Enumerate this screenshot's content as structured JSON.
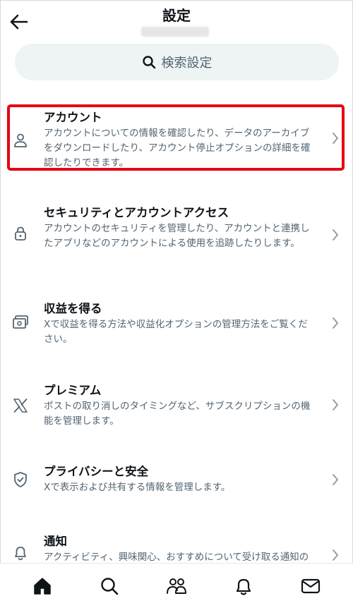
{
  "header": {
    "title": "設定",
    "back_icon": "arrow-left-icon"
  },
  "search": {
    "label": "検索設定",
    "icon": "search-icon"
  },
  "items": [
    {
      "label": "アカウント",
      "desc": "アカウントについての情報を確認したり、データのアーカイブをダウンロードしたり、アカウント停止オプションの詳細を確認したりできます。",
      "icon": "person-icon",
      "highlighted": true
    },
    {
      "label": "セキュリティとアカウントアクセス",
      "desc": "アカウントのセキュリティを管理したり、アカウントと連携したアプリなどのアカウントによる使用を追跡したりします。",
      "icon": "lock-icon"
    },
    {
      "label": "収益を得る",
      "desc": "Xで収益を得る方法や収益化オプションの管理方法をご覧ください。",
      "icon": "money-icon"
    },
    {
      "label": "プレミアム",
      "desc": "ポストの取り消しのタイミングなど、サブスクリプションの機能を管理します。",
      "icon": "x-logo-icon"
    },
    {
      "label": "プライバシーと安全",
      "desc": "Xで表示および共有する情報を管理します。",
      "icon": "shield-icon"
    },
    {
      "label": "通知",
      "desc": "アクティビティ、興味関心、おすすめについて受け取る通知の種類を選択します。",
      "icon": "bell-icon"
    }
  ],
  "bottom_nav": [
    "home-icon",
    "search-icon",
    "communities-icon",
    "notifications-icon",
    "messages-icon"
  ],
  "colors": {
    "highlight": "#e60012",
    "search_bg": "#eef3f4",
    "secondary_text": "#536471",
    "primary_text": "#0f1419"
  }
}
